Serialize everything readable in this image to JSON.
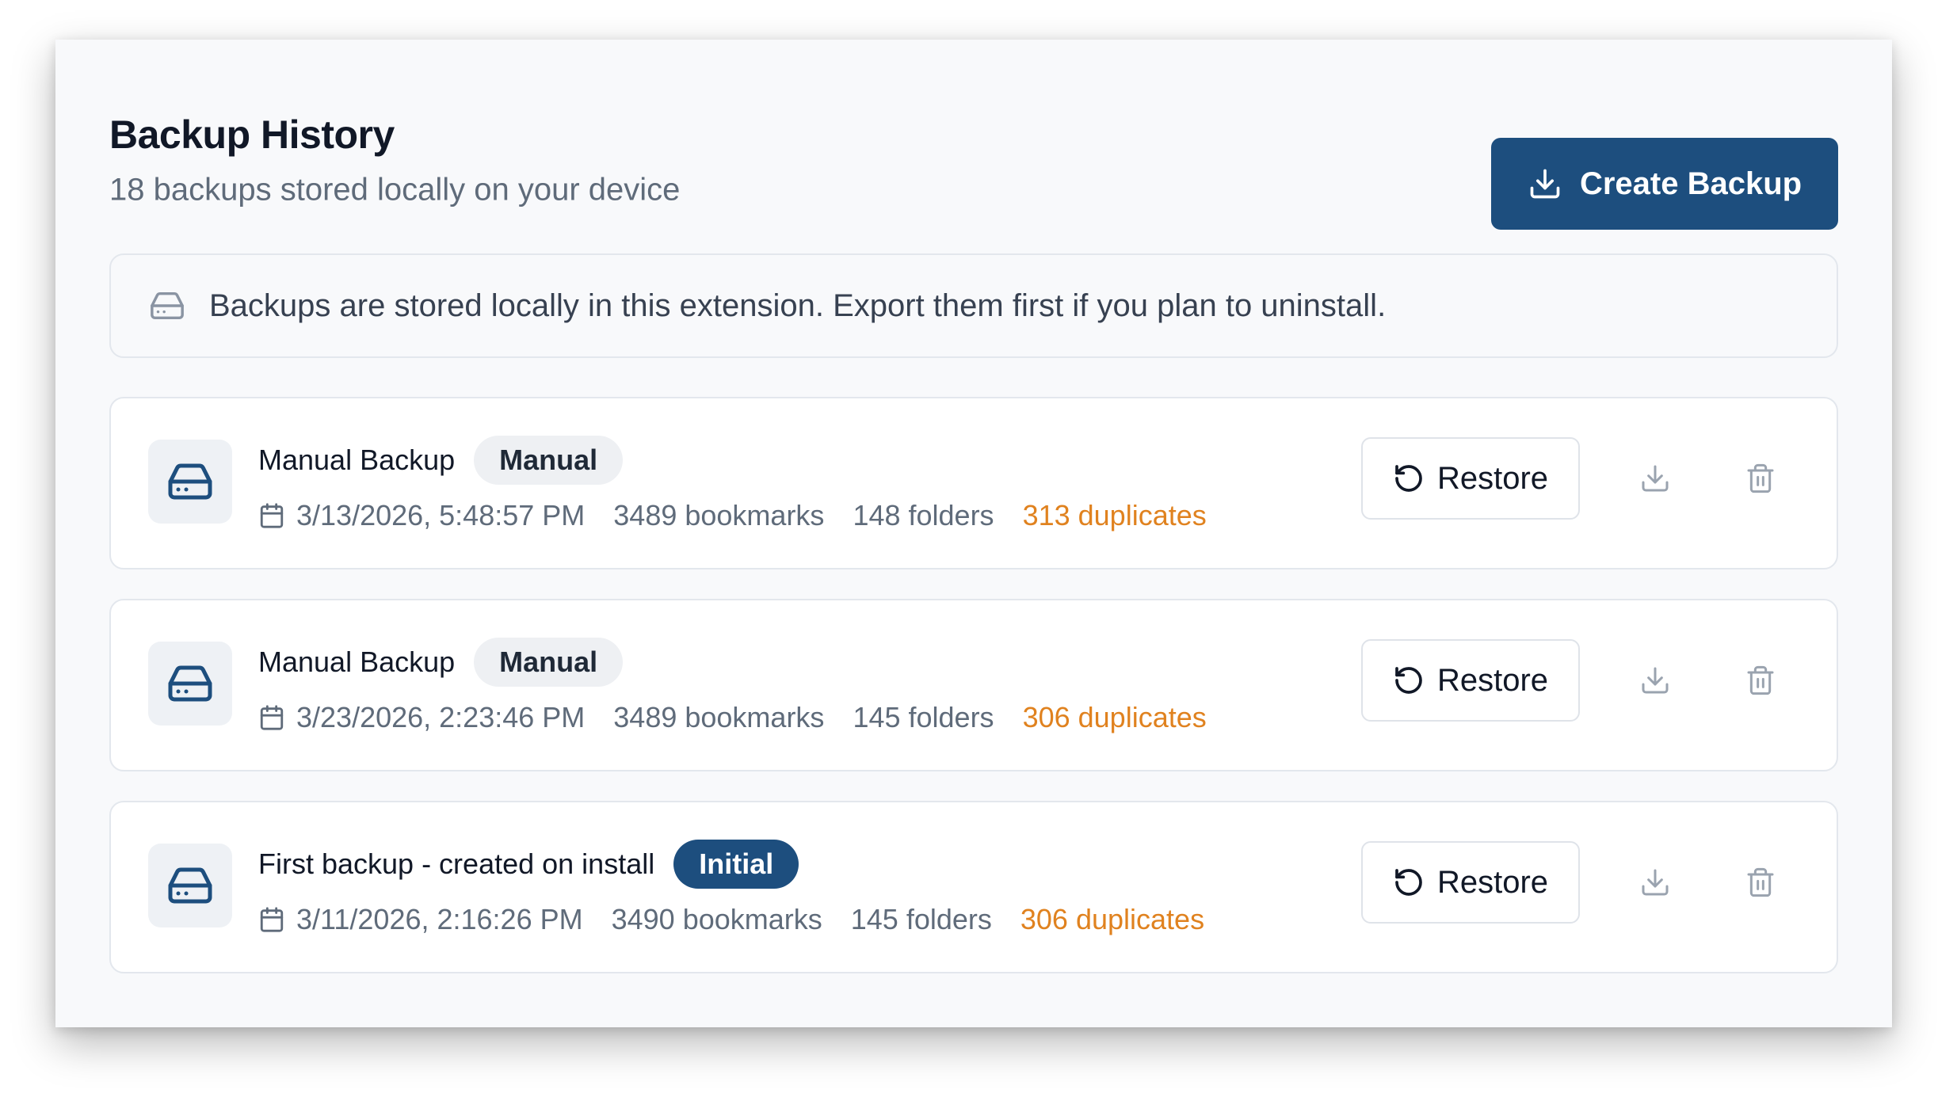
{
  "header": {
    "title": "Backup History",
    "subtitle": "18 backups stored locally on your device",
    "create_button_label": "Create Backup",
    "create_button_icon": "download-icon"
  },
  "notice": {
    "icon": "hard-drive-icon",
    "text": "Backups are stored locally in this extension. Export them first if you plan to uninstall."
  },
  "backups": [
    {
      "name": "Manual Backup",
      "badge": "Manual",
      "date": "3/13/2026, 5:48:57 PM",
      "bookmarks": "3489 bookmarks",
      "folders": "148 folders",
      "duplicates": "313 duplicates",
      "restore_label": "Restore"
    },
    {
      "name": "Manual Backup",
      "badge": "Manual",
      "date": "3/23/2026, 2:23:46 PM",
      "bookmarks": "3489 bookmarks",
      "folders": "145 folders",
      "duplicates": "306 duplicates",
      "restore_label": "Restore"
    },
    {
      "name": "First backup - created on install",
      "badge": "Initial",
      "date": "3/11/2026, 2:16:26 PM",
      "bookmarks": "3490 bookmarks",
      "folders": "145 folders",
      "duplicates": "306 duplicates",
      "restore_label": "Restore"
    }
  ],
  "colors": {
    "primary": "#1d4e7e",
    "duplicates": "#e0821f",
    "muted_text": "#5f6b7a",
    "panel_background": "#f8f9fb"
  },
  "icons": {
    "card": "hard-drive-icon",
    "date": "calendar-icon",
    "restore": "restore-icon",
    "download": "download-icon",
    "delete": "trash-icon"
  }
}
